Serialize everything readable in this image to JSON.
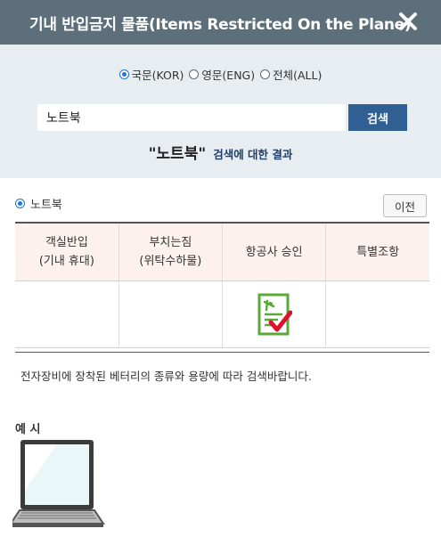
{
  "header": {
    "title": "기내 반입금지 물품(Items Restricted On the Plane)",
    "close_icon": "close-icon"
  },
  "search": {
    "languages": [
      {
        "label": "국문(KOR)",
        "selected": true
      },
      {
        "label": "영문(ENG)",
        "selected": false
      },
      {
        "label": "전체(ALL)",
        "selected": false
      }
    ],
    "input_value": "노트북",
    "button_label": "검색",
    "result_term": "\"노트북\"",
    "result_suffix": "검색에 대한 결과"
  },
  "result": {
    "item_label": "노트북",
    "prev_button": "이전",
    "columns": [
      {
        "line1": "객실반입",
        "line2": "(기내 휴대)"
      },
      {
        "line1": "부치는짐",
        "line2": "(위탁수하물)"
      },
      {
        "line1": "항공사 승인",
        "line2": ""
      },
      {
        "line1": "특별조항",
        "line2": ""
      }
    ],
    "row_icons": [
      "",
      "",
      "airline-approval-checklist-icon",
      ""
    ],
    "notice": "전자장비에 장착된 베터리의 종류와 용량에 따라 검색바랍니다.",
    "example_label": "예 시",
    "example_image": "laptop-icon"
  },
  "colors": {
    "header_bg": "#5c6f7a",
    "panel_bg": "#e8edf2",
    "search_button": "#2f5f93",
    "table_header_bg": "#fdf1ed",
    "approval_green": "#5aa83a",
    "check_red": "#e0102a"
  }
}
